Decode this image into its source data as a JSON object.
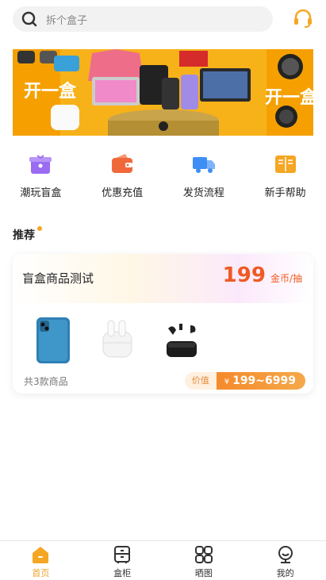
{
  "search": {
    "placeholder": "拆个盒子",
    "icon": "search-icon"
  },
  "header": {
    "service_icon": "headset-icon"
  },
  "banner": {
    "text": "开一盒"
  },
  "quick_nav": [
    {
      "label": "潮玩盲盒",
      "icon": "gift-box-icon",
      "color": "#9b6bf2"
    },
    {
      "label": "优惠充值",
      "icon": "wallet-icon",
      "color": "#f0683a"
    },
    {
      "label": "发货流程",
      "icon": "truck-icon",
      "color": "#3d8ff5"
    },
    {
      "label": "新手帮助",
      "icon": "book-icon",
      "color": "#f5a623"
    }
  ],
  "section": {
    "title": "推荐"
  },
  "card": {
    "title": "盲盒商品测试",
    "price": "199",
    "price_unit": "金币/抽",
    "goods": [
      "iphone-image",
      "airpods-image",
      "earbuds-image"
    ],
    "count_text": "共3款商品",
    "range_label": "价值",
    "currency": "¥",
    "range_value": "199~6999"
  },
  "tabbar": [
    {
      "label": "首页",
      "icon": "home-icon",
      "active": true
    },
    {
      "label": "盒柜",
      "icon": "cabinet-icon",
      "active": false
    },
    {
      "label": "晒图",
      "icon": "grid-icon",
      "active": false
    },
    {
      "label": "我的",
      "icon": "user-icon",
      "active": false
    }
  ],
  "colors": {
    "accent": "#f5a623",
    "price": "#ef5a24",
    "active_tab": "#e8a42c"
  }
}
